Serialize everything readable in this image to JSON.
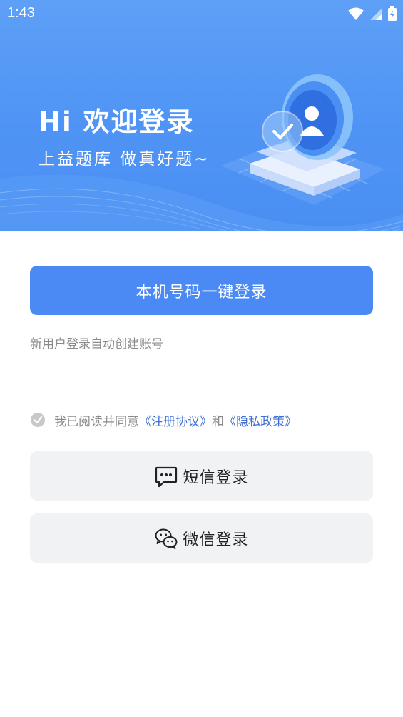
{
  "status_bar": {
    "time": "1:43"
  },
  "hero": {
    "greeting": "Hi 欢迎登录",
    "slogan": "上益题库  做真好题~"
  },
  "login": {
    "one_click_label": "本机号码一键登录",
    "auto_create_hint": "新用户登录自动创建账号",
    "agreement": {
      "prefix": "我已阅读并同意",
      "register_link": "《注册协议》",
      "conjunction": "和",
      "privacy_link": "《隐私政策》",
      "checked": true
    },
    "sms_label": "短信登录",
    "wechat_label": "微信登录"
  },
  "colors": {
    "primary": "#4b8af5",
    "link": "#3d6fd0",
    "secondary_bg": "#f1f2f4"
  }
}
